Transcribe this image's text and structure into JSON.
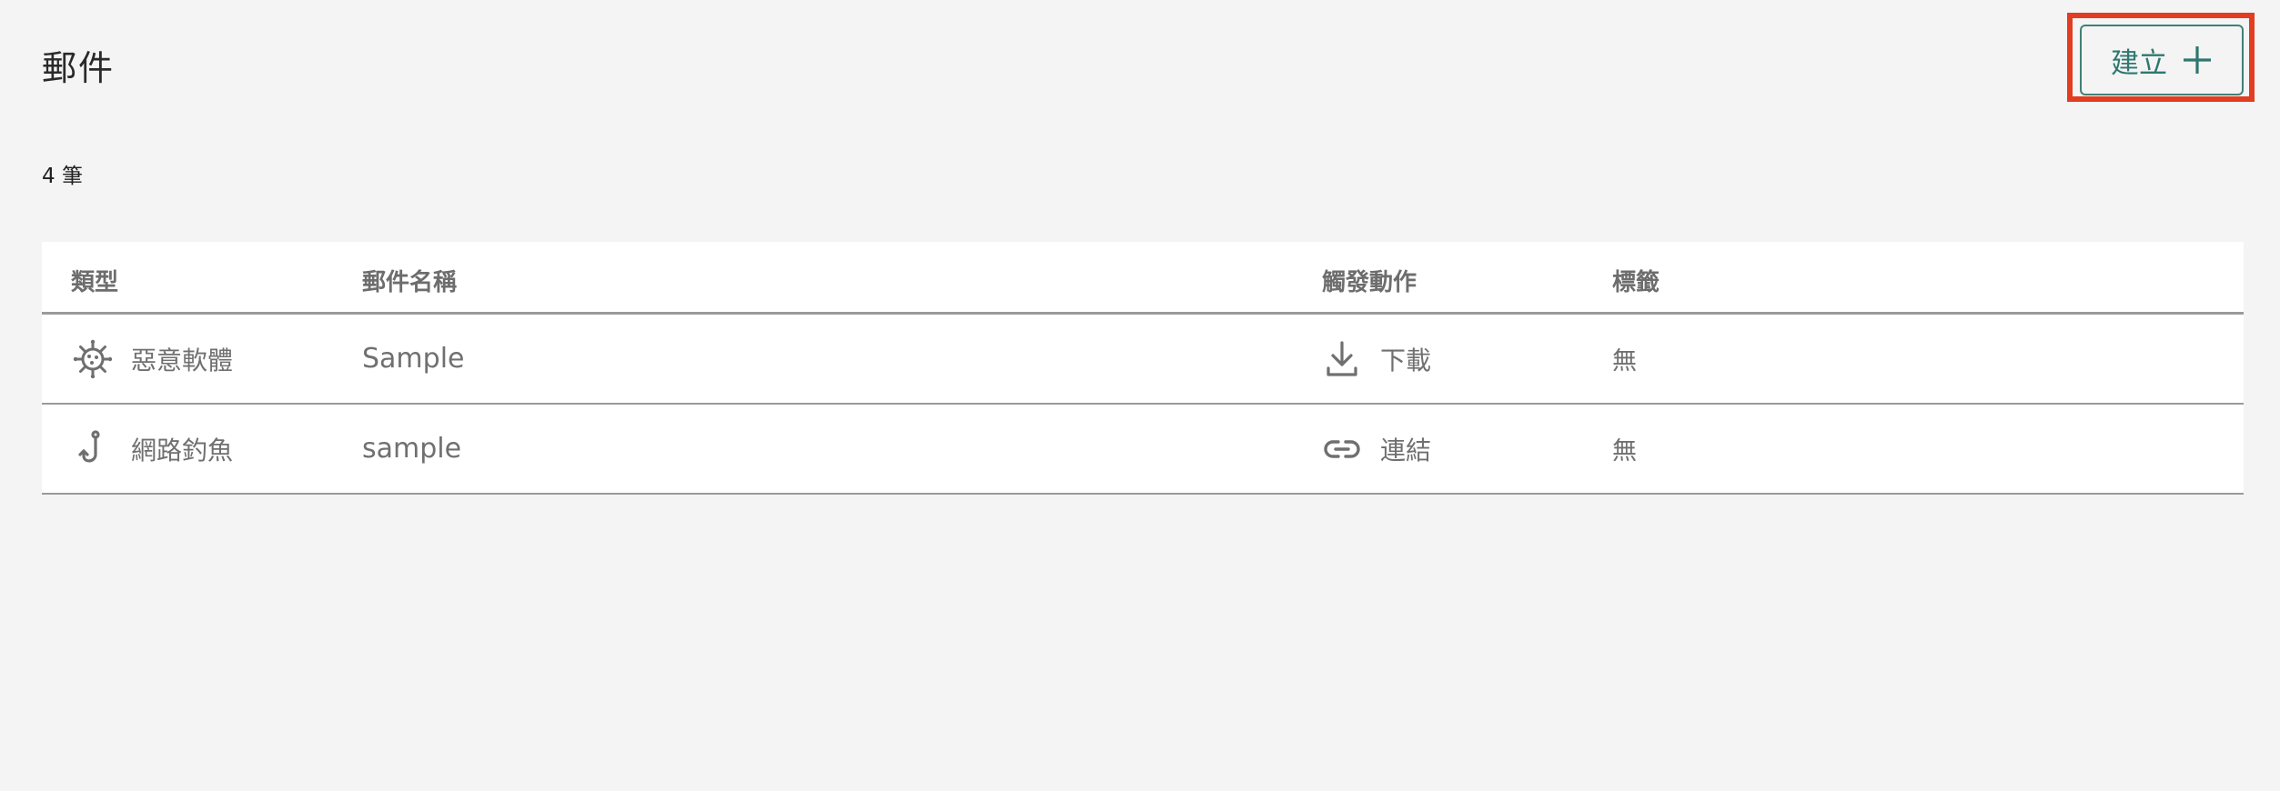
{
  "page": {
    "title": "郵件",
    "count_text": "4 筆"
  },
  "toolbar": {
    "create_label": "建立",
    "create_icon": "plus-icon"
  },
  "table": {
    "columns": [
      "類型",
      "郵件名稱",
      "觸發動作",
      "標籤"
    ],
    "rows": [
      {
        "type_icon": "virus-icon",
        "type": "惡意軟體",
        "name": "Sample",
        "action_icon": "download-icon",
        "action": "下載",
        "label": "無"
      },
      {
        "type_icon": "fishhook-icon",
        "type": "網路釣魚",
        "name": "sample",
        "action_icon": "link-icon",
        "action": "連結",
        "label": "無"
      }
    ]
  },
  "colors": {
    "accent": "#2f7770",
    "highlight": "#e23d22",
    "background": "#f3f4f3"
  }
}
